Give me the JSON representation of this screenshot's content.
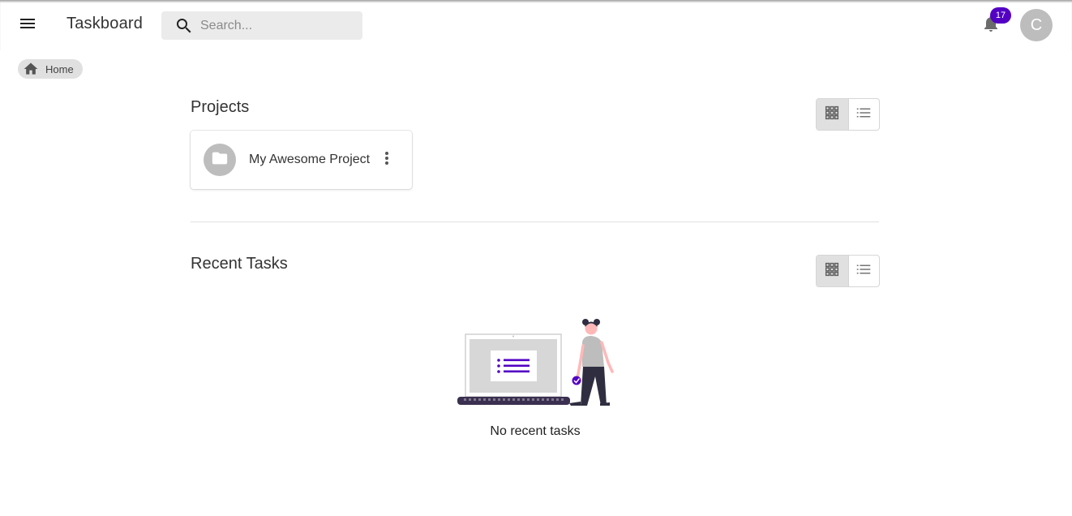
{
  "header": {
    "menu_icon": "menu-icon",
    "app_title": "Taskboard",
    "search": {
      "placeholder": "Search...",
      "value": "",
      "icon": "search-icon"
    },
    "notifications": {
      "icon": "bell-icon",
      "count": "17"
    },
    "avatar_initial": "C"
  },
  "breadcrumb": {
    "icon": "home-icon",
    "label": "Home"
  },
  "projects": {
    "title": "Projects",
    "view_toggle": {
      "selected": "grid",
      "options": [
        "grid",
        "list"
      ]
    },
    "items": [
      {
        "name": "My Awesome Project",
        "icon": "folder-icon"
      }
    ]
  },
  "recent_tasks": {
    "title": "Recent Tasks",
    "view_toggle": {
      "selected": "grid",
      "options": [
        "grid",
        "list"
      ]
    },
    "empty_text": "No recent tasks"
  },
  "colors": {
    "accent": "#5300c4",
    "avatar_bg": "#bdbdbd",
    "search_bg": "#ebebeb",
    "chip_bg": "#e0e0e0"
  }
}
